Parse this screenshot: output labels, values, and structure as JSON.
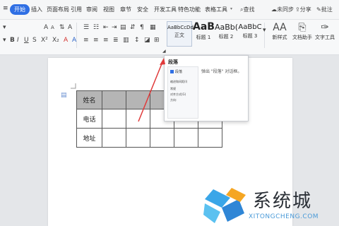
{
  "menubar": {
    "menu_icon": "hamburger-icon",
    "tabs": [
      "开始",
      "插入",
      "页面布局",
      "引用",
      "审阅",
      "视图",
      "章节",
      "安全",
      "开发工具",
      "特色功能",
      "表格工具"
    ],
    "search_label": "查找",
    "sync_label": "未同步",
    "share_label": "分享",
    "comment_label": "批注"
  },
  "ribbon": {
    "font_size_up": "A",
    "font_size_down": "A",
    "font_color_letter": "A",
    "highlight_letter": "A",
    "clear_format_letter": "A",
    "styles": [
      {
        "preview": "AaBbCcDd",
        "name": "正文"
      },
      {
        "preview": "AaBt",
        "name": "标题 1"
      },
      {
        "preview": "AaBb(",
        "name": "标题 2"
      },
      {
        "preview": "AaBbC",
        "name": "标题 3"
      }
    ],
    "new_style_preview": "AA",
    "new_style_label": "新样式",
    "doc_helper_label": "文档助手",
    "text_tools_label": "文字工具"
  },
  "document": {
    "table": {
      "rows": [
        [
          "姓名",
          "",
          "",
          "",
          "",
          ""
        ],
        [
          "电话",
          "",
          "",
          "",
          "",
          ""
        ],
        [
          "地址",
          "",
          "",
          "",
          "",
          ""
        ]
      ]
    }
  },
  "popup": {
    "title": "段落",
    "description": "弹出 \"段落\" 对话框。",
    "mini_title": "段落",
    "mini_lines": [
      "缩进和间距(I)",
      "常规",
      "对齐方式(G)",
      "方向:"
    ]
  },
  "watermark": {
    "brand": "系统城",
    "url": "XITONGCHENG.COM"
  },
  "colors": {
    "accent": "#2f6fe4",
    "table_header": "#b5b5b5",
    "arrow": "#e03a3a"
  }
}
